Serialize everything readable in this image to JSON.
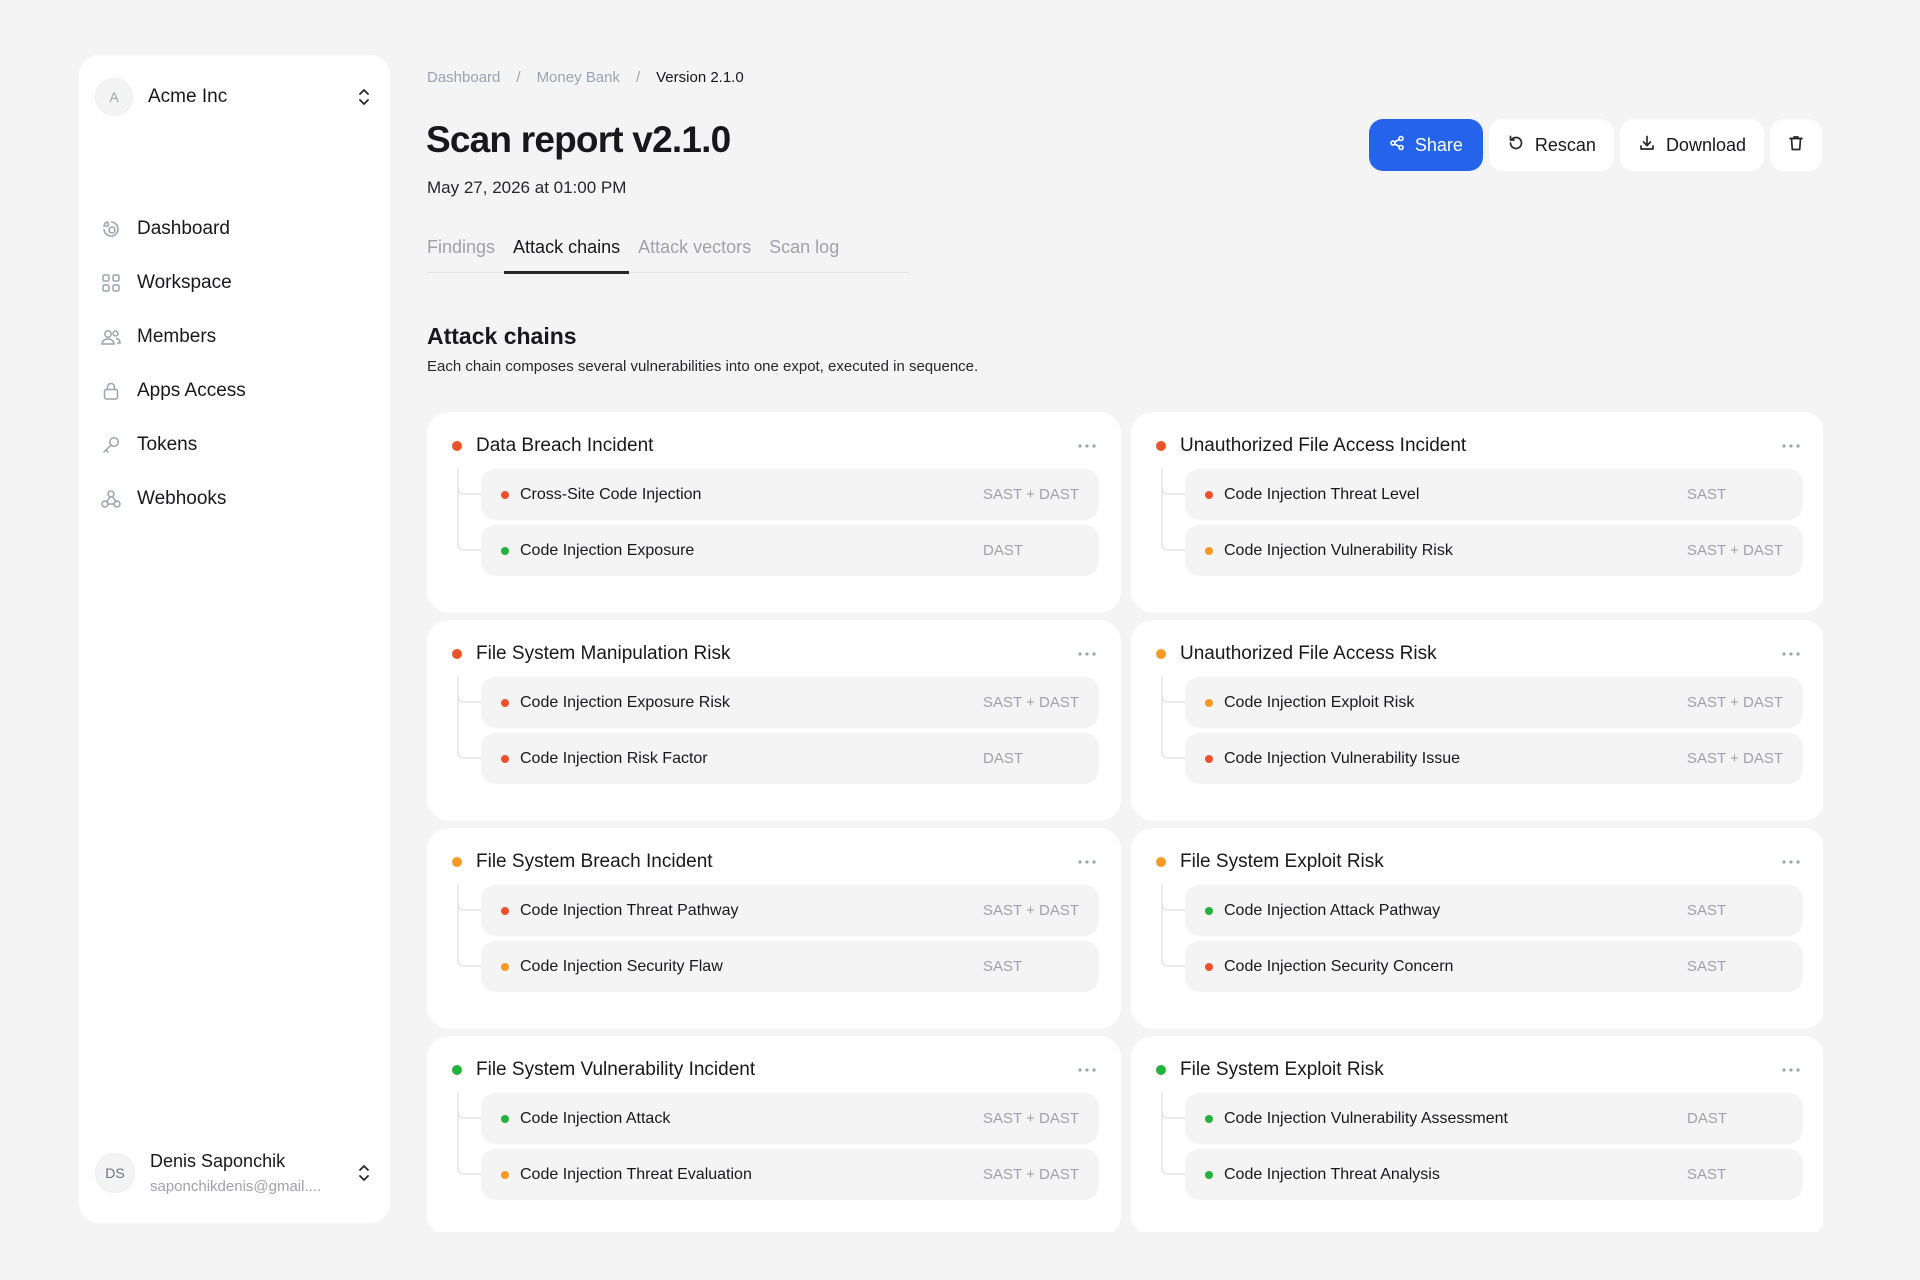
{
  "org": {
    "initial": "A",
    "name": "Acme Inc"
  },
  "nav": [
    {
      "label": "Dashboard",
      "icon": "dashboard-icon"
    },
    {
      "label": "Workspace",
      "icon": "grid-icon"
    },
    {
      "label": "Members",
      "icon": "users-icon"
    },
    {
      "label": "Apps Access",
      "icon": "lock-icon"
    },
    {
      "label": "Tokens",
      "icon": "key-icon"
    },
    {
      "label": "Webhooks",
      "icon": "webhook-icon"
    }
  ],
  "user": {
    "initials": "DS",
    "name": "Denis Saponchik",
    "email": "saponchikdenis@gmail...."
  },
  "breadcrumb": [
    "Dashboard",
    "Money Bank",
    "Version 2.1.0"
  ],
  "page": {
    "title": "Scan report v2.1.0",
    "date": "May 27, 2026 at 01:00 PM"
  },
  "actions": {
    "share": "Share",
    "rescan": "Rescan",
    "download": "Download"
  },
  "tabs": [
    {
      "label": "Findings",
      "active": false
    },
    {
      "label": "Attack chains",
      "active": true
    },
    {
      "label": "Attack vectors",
      "active": false
    },
    {
      "label": "Scan log",
      "active": false
    }
  ],
  "section": {
    "title": "Attack chains",
    "description": "Each chain composes several vulnerabilities into one expot, executed in sequence."
  },
  "colors": {
    "red": "#f0522b",
    "orange": "#f59a23",
    "green": "#22b43a",
    "accent": "#2563eb"
  },
  "chains": [
    {
      "title": "Data Breach Incident",
      "severity": "red",
      "items": [
        {
          "label": "Cross-Site Code Injection",
          "severity": "red",
          "tag": "SAST + DAST"
        },
        {
          "label": "Code Injection Exposure",
          "severity": "green",
          "tag": "DAST"
        }
      ]
    },
    {
      "title": "Unauthorized File Access Incident",
      "severity": "red",
      "items": [
        {
          "label": "Code Injection Threat Level",
          "severity": "red",
          "tag": "SAST"
        },
        {
          "label": "Code Injection Vulnerability Risk",
          "severity": "orange",
          "tag": "SAST + DAST"
        }
      ]
    },
    {
      "title": "File System Manipulation Risk",
      "severity": "red",
      "items": [
        {
          "label": "Code Injection Exposure Risk",
          "severity": "red",
          "tag": "SAST + DAST"
        },
        {
          "label": "Code Injection Risk Factor",
          "severity": "red",
          "tag": "DAST"
        }
      ]
    },
    {
      "title": "Unauthorized File Access Risk",
      "severity": "orange",
      "items": [
        {
          "label": "Code Injection Exploit Risk",
          "severity": "orange",
          "tag": "SAST + DAST"
        },
        {
          "label": "Code Injection Vulnerability Issue",
          "severity": "red",
          "tag": "SAST + DAST"
        }
      ]
    },
    {
      "title": "File System Breach Incident",
      "severity": "orange",
      "items": [
        {
          "label": "Code Injection Threat Pathway",
          "severity": "red",
          "tag": "SAST + DAST"
        },
        {
          "label": "Code Injection Security Flaw",
          "severity": "orange",
          "tag": "SAST"
        }
      ]
    },
    {
      "title": "File System Exploit Risk",
      "severity": "orange",
      "items": [
        {
          "label": "Code Injection Attack Pathway",
          "severity": "green",
          "tag": "SAST"
        },
        {
          "label": "Code Injection Security Concern",
          "severity": "red",
          "tag": "SAST"
        }
      ]
    },
    {
      "title": "File System Vulnerability Incident",
      "severity": "green",
      "items": [
        {
          "label": "Code Injection Attack",
          "severity": "green",
          "tag": "SAST + DAST"
        },
        {
          "label": "Code Injection Threat Evaluation",
          "severity": "orange",
          "tag": "SAST + DAST"
        }
      ]
    },
    {
      "title": "File System Exploit Risk",
      "severity": "green",
      "items": [
        {
          "label": "Code Injection Vulnerability Assessment",
          "severity": "green",
          "tag": "DAST"
        },
        {
          "label": "Code Injection Threat Analysis",
          "severity": "green",
          "tag": "SAST"
        }
      ]
    }
  ]
}
